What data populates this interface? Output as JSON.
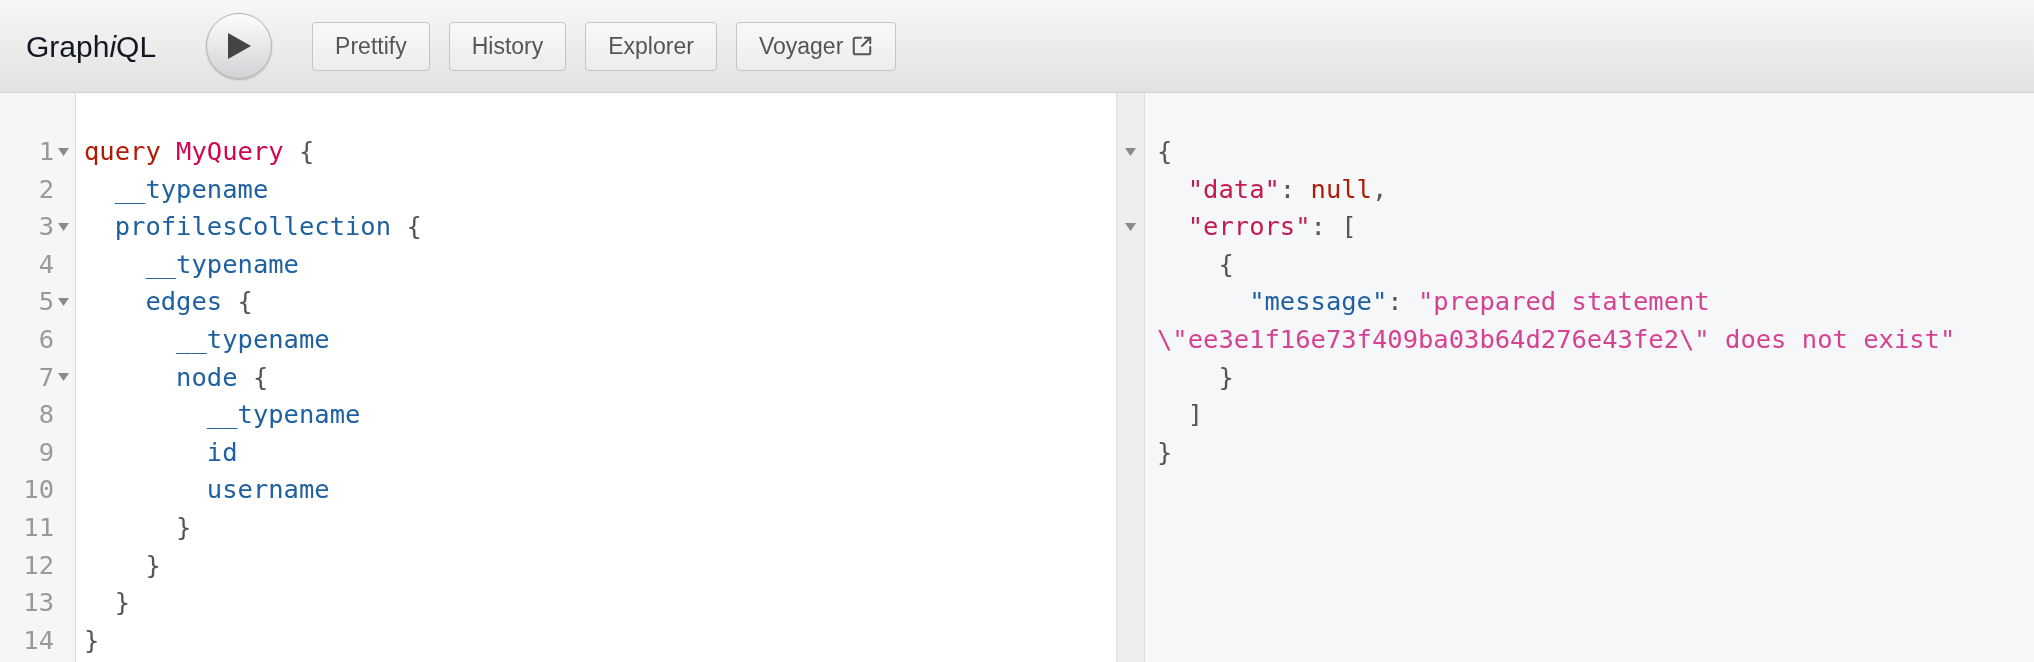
{
  "toolbar": {
    "logo": [
      {
        "text": "Graph",
        "italic": false
      },
      {
        "text": "i",
        "italic": true
      },
      {
        "text": "QL",
        "italic": false
      }
    ],
    "buttons": [
      {
        "label": "Prettify",
        "external": false
      },
      {
        "label": "History",
        "external": false
      },
      {
        "label": "Explorer",
        "external": false
      },
      {
        "label": "Voyager",
        "external": true
      }
    ]
  },
  "editor": {
    "lines": [
      {
        "number": "1",
        "foldable": true,
        "tokens": [
          {
            "kind": "keyword",
            "text": "query"
          },
          {
            "kind": "def",
            "text": " MyQuery"
          },
          {
            "kind": "punctuation",
            "text": " {"
          }
        ]
      },
      {
        "number": "2",
        "foldable": false,
        "tokens": [
          {
            "kind": "property",
            "text": "  __typename"
          }
        ]
      },
      {
        "number": "3",
        "foldable": true,
        "tokens": [
          {
            "kind": "property",
            "text": "  profilesCollection"
          },
          {
            "kind": "punctuation",
            "text": " {"
          }
        ]
      },
      {
        "number": "4",
        "foldable": false,
        "tokens": [
          {
            "kind": "property",
            "text": "    __typename"
          }
        ]
      },
      {
        "number": "5",
        "foldable": true,
        "tokens": [
          {
            "kind": "property",
            "text": "    edges"
          },
          {
            "kind": "punctuation",
            "text": " {"
          }
        ]
      },
      {
        "number": "6",
        "foldable": false,
        "tokens": [
          {
            "kind": "property",
            "text": "      __typename"
          }
        ]
      },
      {
        "number": "7",
        "foldable": true,
        "tokens": [
          {
            "kind": "property",
            "text": "      node"
          },
          {
            "kind": "punctuation",
            "text": " {"
          }
        ]
      },
      {
        "number": "8",
        "foldable": false,
        "tokens": [
          {
            "kind": "property",
            "text": "        __typename"
          }
        ]
      },
      {
        "number": "9",
        "foldable": false,
        "tokens": [
          {
            "kind": "property",
            "text": "        id"
          }
        ]
      },
      {
        "number": "10",
        "foldable": false,
        "tokens": [
          {
            "kind": "property",
            "text": "        username"
          }
        ]
      },
      {
        "number": "11",
        "foldable": false,
        "tokens": [
          {
            "kind": "punctuation",
            "text": "      }"
          }
        ]
      },
      {
        "number": "12",
        "foldable": false,
        "tokens": [
          {
            "kind": "punctuation",
            "text": "    }"
          }
        ]
      },
      {
        "number": "13",
        "foldable": false,
        "tokens": [
          {
            "kind": "punctuation",
            "text": "  }"
          }
        ]
      },
      {
        "number": "14",
        "foldable": false,
        "tokens": [
          {
            "kind": "punctuation",
            "text": "}"
          }
        ]
      }
    ]
  },
  "result": {
    "lines": [
      {
        "foldable": true,
        "tokens": [
          {
            "kind": "punctuation",
            "text": "{"
          }
        ]
      },
      {
        "foldable": false,
        "tokens": [
          {
            "kind": "key",
            "text": "  \"data\""
          },
          {
            "kind": "punctuation",
            "text": ": "
          },
          {
            "kind": "keyword",
            "text": "null"
          },
          {
            "kind": "punctuation",
            "text": ","
          }
        ]
      },
      {
        "foldable": true,
        "tokens": [
          {
            "kind": "key",
            "text": "  \"errors\""
          },
          {
            "kind": "punctuation",
            "text": ": ["
          }
        ]
      },
      {
        "foldable": false,
        "tokens": [
          {
            "kind": "punctuation",
            "text": "    {"
          }
        ]
      },
      {
        "foldable": false,
        "tokens": [
          {
            "kind": "property",
            "text": "      \"message\""
          },
          {
            "kind": "punctuation",
            "text": ": "
          },
          {
            "kind": "string",
            "text": "\"prepared statement \\\"ee3e1f16e73f409ba03b64d276e43fe2\\\" does not exist\""
          }
        ]
      },
      {
        "foldable": false,
        "tokens": [
          {
            "kind": "punctuation",
            "text": "    }"
          }
        ]
      },
      {
        "foldable": false,
        "tokens": [
          {
            "kind": "punctuation",
            "text": "  ]"
          }
        ]
      },
      {
        "foldable": false,
        "tokens": [
          {
            "kind": "punctuation",
            "text": "}"
          }
        ]
      }
    ]
  }
}
